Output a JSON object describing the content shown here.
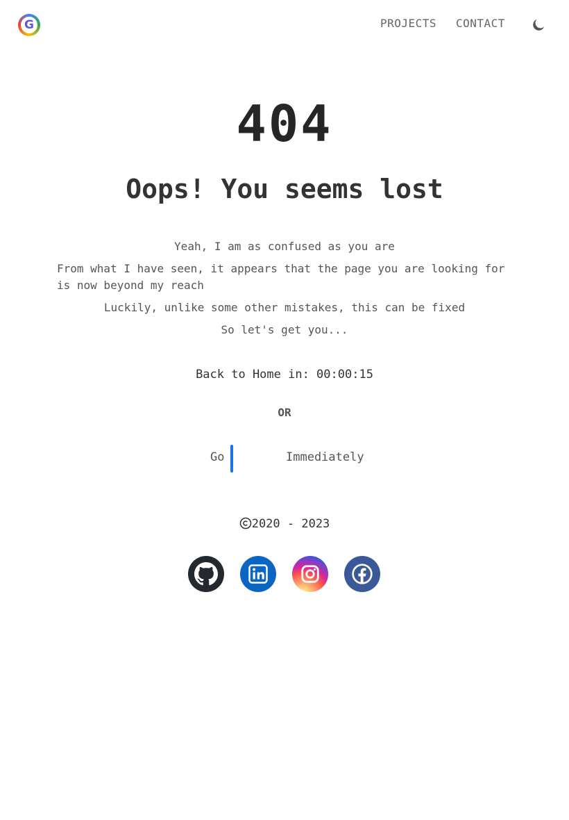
{
  "header": {
    "logo_letter": "G",
    "nav": [
      {
        "label": "PROJECTS"
      },
      {
        "label": "CONTACT"
      }
    ],
    "theme_toggle_icon": "moon-icon"
  },
  "main": {
    "code": "404",
    "headline": "Oops! You seems lost",
    "paragraphs": [
      "Yeah, I am as confused as you are",
      "From what I have seen, it appears that the page you are looking for is now beyond my reach",
      "Luckily, unlike some other mistakes, this can be fixed",
      "So let's get you..."
    ],
    "countdown": "Back to Home in: 00:00:15",
    "or_label": "OR",
    "go_word": "Go",
    "immediately_word": "Immediately"
  },
  "footer": {
    "copyright_text": "2020 - 2023",
    "socials": [
      {
        "name": "github-icon",
        "color": "#24292f"
      },
      {
        "name": "linkedin-icon",
        "color": "#0a66c2"
      },
      {
        "name": "instagram-icon",
        "color": "#d6249f"
      },
      {
        "name": "facebook-icon",
        "color": "#3b5998"
      }
    ]
  },
  "colors": {
    "accent": "#1a73e8",
    "text": "#262626"
  }
}
